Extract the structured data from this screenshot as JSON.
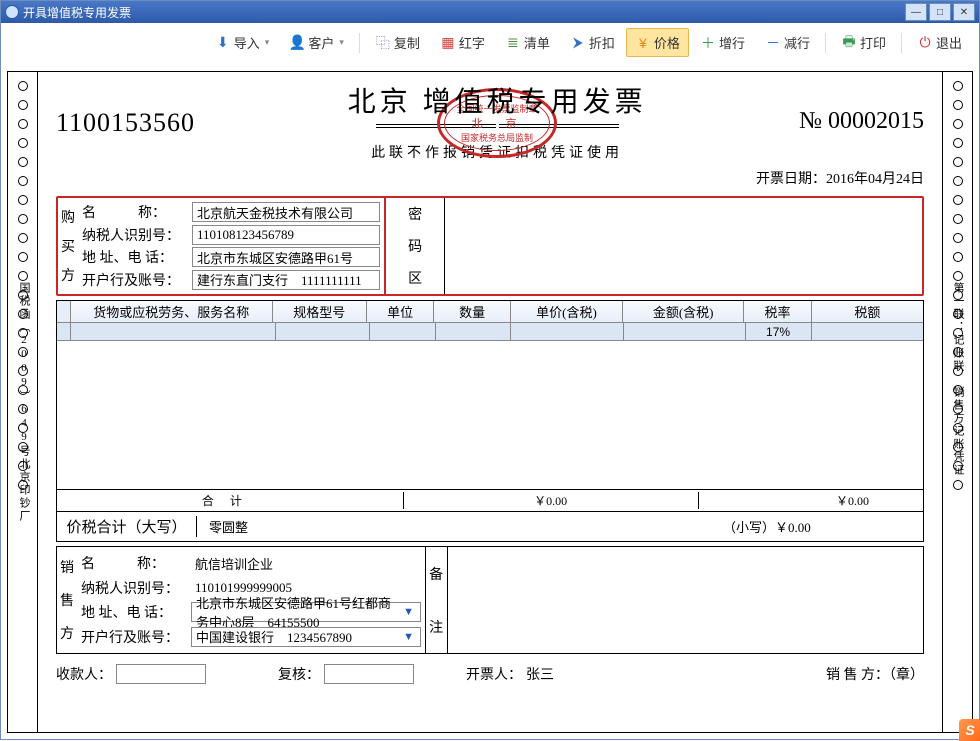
{
  "window": {
    "title": "开具增值税专用发票"
  },
  "toolbar": {
    "import": "导入",
    "customer": "客户",
    "copy": "复制",
    "red": "红字",
    "list": "清单",
    "discount": "折扣",
    "price": "价格",
    "addrow": "增行",
    "delrow": "减行",
    "print": "打印",
    "exit": "退出"
  },
  "invoice": {
    "code": "1100153560",
    "title": "北京 增值税专用发票",
    "stamp1": "全国统一发票监制章",
    "stamp2": "北　京",
    "stamp3": "国家税务总局监制",
    "subline": "此联不作报销凭证扣税凭证使用",
    "no_label": "№",
    "no": "00002015",
    "date_label": "开票日期：",
    "date": "2016年04月24日"
  },
  "buyer": {
    "section": "购买方",
    "name_label": "名　　　称：",
    "name": "北京航天金税技术有限公司",
    "taxid_label": "纳税人识别号：",
    "taxid": "110108123456789",
    "addr_label": "地 址、电 话：",
    "addr": "北京市东城区安德路甲61号",
    "bank_label": "开户行及账号：",
    "bank": "建行东直门支行　1111111111",
    "mima": "密码区"
  },
  "columns": {
    "name": "货物或应税劳务、服务名称",
    "spec": "规格型号",
    "unit": "单位",
    "qty": "数量",
    "price": "单价(含税)",
    "amount": "金额(含税)",
    "rate": "税率",
    "tax": "税额"
  },
  "row1_rate": "17%",
  "sum": {
    "label": "合计",
    "amount": "￥0.00",
    "tax": "￥0.00"
  },
  "total": {
    "label": "价税合计（大写）",
    "cn": "零圆整",
    "small_label": "（小写）",
    "small": "￥0.00"
  },
  "seller": {
    "section": "销售方",
    "name_label": "名　　　称：",
    "name": "航信培训企业",
    "taxid_label": "纳税人识别号：",
    "taxid": "110101999999005",
    "addr_label": "地 址、电 话：",
    "addr": "北京市东城区安德路甲61号红都商务中心8层　64155500",
    "bank_label": "开户行及账号：",
    "bank": "中国建设银行　1234567890",
    "beizhu": "备注"
  },
  "footer": {
    "payee": "收款人：",
    "reviewer": "复核：",
    "drawer_label": "开票人：",
    "drawer": "张三",
    "seller_stamp": "销 售 方：（章）"
  },
  "side": {
    "left": "国税函〔2009〕649号北京印钞厂",
    "right": "第一联：记账联　销售方记账凭证"
  },
  "icons": {
    "import": "#2f70c9",
    "customer": "#e07c2b",
    "copy": "#7b4bc4",
    "red": "#d04040",
    "list": "#4b8f3f",
    "discount": "#2f70c9",
    "price": "#e68a1a",
    "addrow": "#3a9a52",
    "delrow": "#2f70c9",
    "print": "#3a9a52",
    "exit": "#d03030"
  }
}
